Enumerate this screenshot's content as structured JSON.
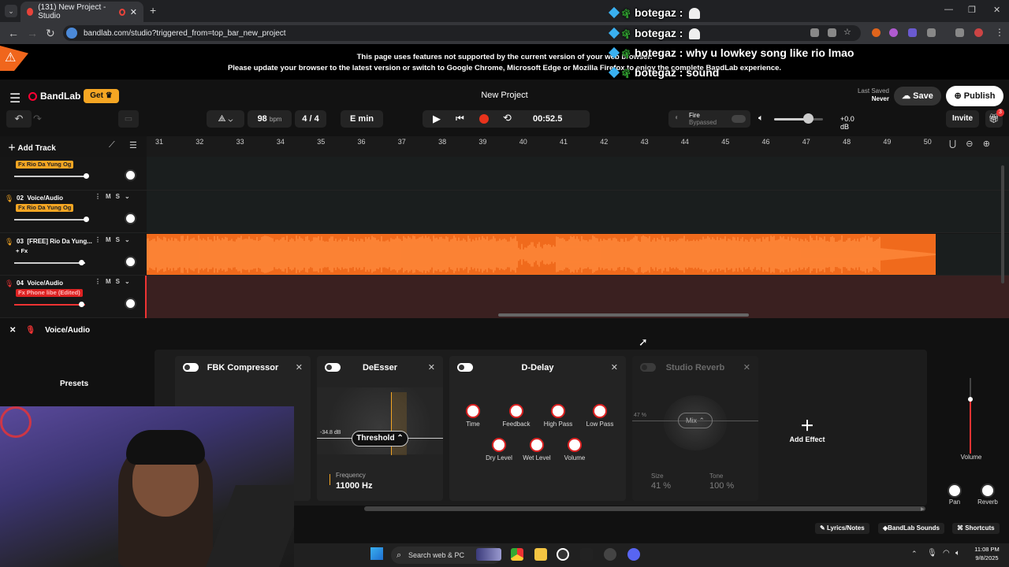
{
  "browser": {
    "tab_title": "(131) New Project - Studio",
    "tab_close": "✕",
    "new_tab": "+",
    "url": "bandlab.com/studio?triggered_from=top_bar_new_project",
    "window_controls": [
      "—",
      "❐",
      "✕"
    ]
  },
  "warning": {
    "line1": "This page uses features not supported by the current version of your web browser.",
    "line2": "Please update your browser to the latest version or switch to Google Chrome, Microsoft Edge or Mozilla Firefox to enjoy the complete BandLab experience."
  },
  "chat": [
    {
      "user": "botegaz",
      "text": ""
    },
    {
      "user": "botegaz",
      "text": ""
    },
    {
      "user": "botegaz",
      "text": "why u lowkey song like rio lmao"
    },
    {
      "user": "botegaz",
      "text": "sound"
    }
  ],
  "header": {
    "brand": "BandLab",
    "get_label": "Get",
    "project_title": "New Project",
    "last_saved_label": "Last Saved",
    "last_saved_value": "Never",
    "save_label": "Save",
    "publish_label": "Publish"
  },
  "toolbar": {
    "bpm": "98",
    "bpm_unit": "bpm",
    "time_sig": "4 / 4",
    "key": "E min",
    "time": "00:52.5",
    "fx_name": "Fire",
    "fx_state": "Bypassed",
    "master_db": "+0.0 dB",
    "invite_label": "Invite",
    "notif_count": "3",
    "master_volume_level": 0.7
  },
  "timeline": {
    "add_track_label": "Add Track",
    "bars": [
      "31",
      "32",
      "33",
      "34",
      "35",
      "36",
      "37",
      "38",
      "39",
      "40",
      "41",
      "42",
      "43",
      "44",
      "45",
      "46",
      "47",
      "48",
      "49",
      "50"
    ]
  },
  "tracks": [
    {
      "num": "",
      "name": "",
      "fx": "Fx Rio Da Yung Og",
      "fx_style": "yellow"
    },
    {
      "num": "02",
      "name": "Voice/Audio",
      "fx": "Fx Rio Da Yung Og",
      "fx_style": "yellow"
    },
    {
      "num": "03",
      "name": "[FREE] Rio Da Yung...",
      "fx": "+ Fx",
      "fx_style": "plain"
    },
    {
      "num": "04",
      "name": "Voice/Audio",
      "fx": "Fx Phone libe (Edited)",
      "fx_style": "red"
    }
  ],
  "track_buttons": {
    "mute": "M",
    "solo": "S"
  },
  "bottom_panel": {
    "track_name": "Voice/Audio",
    "presets_label": "Presets",
    "effects": [
      {
        "name": "FBK Compressor"
      },
      {
        "name": "DeEsser",
        "threshold_label": "Threshold",
        "db_readout": "-34.8 dB",
        "freq_label": "Frequency",
        "freq_value": "11000 Hz"
      },
      {
        "name": "D-Delay",
        "knobs": [
          "Time",
          "Feedback",
          "High Pass",
          "Low Pass",
          "Dry Level",
          "Wet Level",
          "Volume"
        ]
      },
      {
        "name": "Studio Reverb",
        "mix_label": "Mix",
        "mix_pct": "47 %",
        "size_label": "Size",
        "size_value": "41 %",
        "tone_label": "Tone",
        "tone_value": "100 %"
      }
    ],
    "add_effect_label": "Add Effect",
    "volume_label": "Volume",
    "pan_label": "Pan",
    "reverb_label": "Reverb"
  },
  "footer": {
    "lyrics_label": "Lyrics/Notes",
    "sounds_label": "BandLab Sounds",
    "shortcuts_label": "Shortcuts"
  },
  "taskbar": {
    "search_placeholder": "Search web & PC",
    "time": "11:08 PM",
    "date": "9/8/2025"
  },
  "colors": {
    "accent": "#f5a623",
    "waveform": "#f06a1c",
    "record": "#e8331c",
    "brand": "#ff2b3a"
  }
}
